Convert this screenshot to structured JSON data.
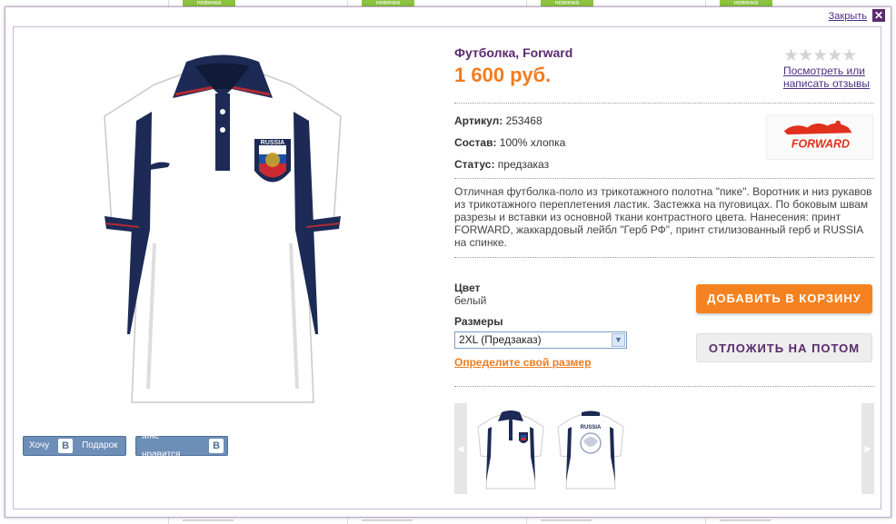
{
  "background": {
    "badge_label": "новинка"
  },
  "modal": {
    "close_label": "Закрыть",
    "close_icon": "close-icon"
  },
  "product": {
    "title": "Футболка, Forward",
    "price": "1 600 руб.",
    "rating_stars": "★★★★★",
    "reviews_link": "Посмотреть или написать отзывы",
    "article_label": "Артикул:",
    "article_value": "253468",
    "composition_label": "Состав:",
    "composition_value": "100% хлопка",
    "status_label": "Статус:",
    "status_value": "предзаказ",
    "brand_logo": "FORWARD",
    "description": "Отличная футболка-поло из трикотажного полотна \"пике\". Воротник и низ рукавов из трикотажного переплетения ластик. Застежка на пуговицах. По боковым швам разрезы и вставки из основной ткани контрастного цвета. Нанесения: принт FORWARD, жаккардовый лейбл \"Герб РФ\", принт стилизованный герб и RUSSIA на спинке.",
    "color_label": "Цвет",
    "color_value": "белый",
    "sizes_label": "Размеры",
    "size_selected": "2XL (Предзаказ)",
    "size_link": "Определите свой размер",
    "emblem_text": "RUSSIA"
  },
  "buttons": {
    "add_to_cart": "ДОБАВИТЬ В КОРЗИНУ",
    "save_later": "ОТЛОЖИТЬ НА ПОТОМ"
  },
  "social": {
    "want_label": "Хочу",
    "vk_letter": "В",
    "gift_label": "Подарок",
    "like_label": "Мне нравится"
  },
  "thumbnails": {
    "prev_icon": "◀",
    "next_icon": "▶"
  },
  "colors": {
    "accent_orange": "#f58220",
    "brand_purple": "#5a2a6e",
    "navy": "#1c2a55",
    "vk_blue": "#6c8eb7"
  }
}
